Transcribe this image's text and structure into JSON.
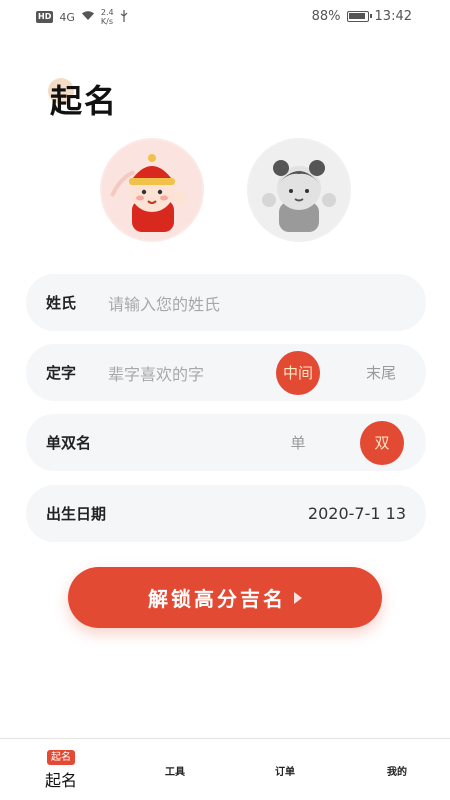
{
  "status_bar": {
    "hd": "HD",
    "signal": "4G",
    "speed_value": "2.4",
    "speed_unit": "K/s",
    "battery_percent": "88%",
    "time": "13:42"
  },
  "page": {
    "title": "起名"
  },
  "avatars": [
    {
      "name": "boy",
      "selected": true
    },
    {
      "name": "girl",
      "selected": false
    }
  ],
  "form": {
    "surname": {
      "label": "姓氏",
      "placeholder": "请输入您的姓氏"
    },
    "fixed_char": {
      "label": "定字",
      "placeholder": "辈字喜欢的字",
      "option_middle": "中间",
      "option_end": "末尾",
      "selected": "中间"
    },
    "name_length": {
      "label": "单双名",
      "option_single": "单",
      "option_double": "双",
      "selected": "双"
    },
    "birth": {
      "label": "出生日期",
      "value": "2020-7-1 13"
    }
  },
  "unlock_button": {
    "label": "解锁高分吉名"
  },
  "bottom_nav": {
    "items": [
      {
        "badge": "起名",
        "label": "起名",
        "active": true
      },
      {
        "label": "工具",
        "active": false
      },
      {
        "label": "订单",
        "active": false
      },
      {
        "label": "我的",
        "active": false
      }
    ]
  },
  "colors": {
    "accent": "#e24a34",
    "row_bg": "#f5f6f8",
    "active_text": "#ffe6c0"
  }
}
